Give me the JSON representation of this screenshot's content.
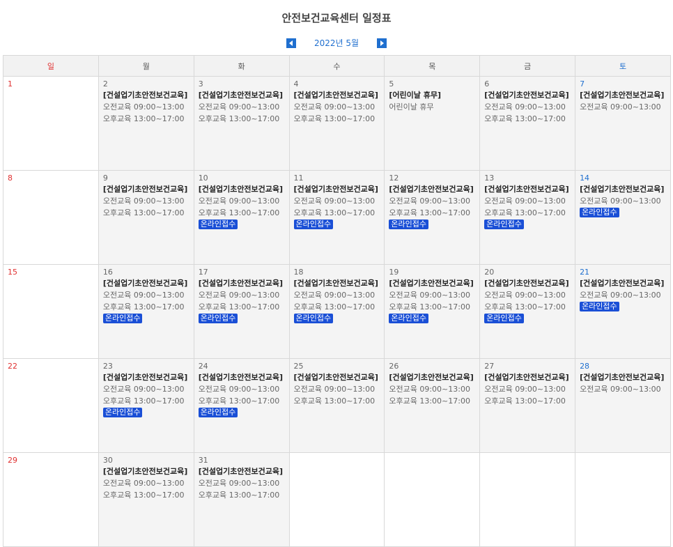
{
  "header": {
    "title": "안전보건교육센터 일정표",
    "month_label": "2022년 5월",
    "prev_icon": "triangle-left",
    "next_icon": "triangle-right"
  },
  "weekdays": [
    "일",
    "월",
    "화",
    "수",
    "목",
    "금",
    "토"
  ],
  "colors": {
    "sunday": "#e03030",
    "saturday": "#1f6fcf",
    "accent": "#1f6fcf",
    "badge": "#1a4fd6"
  },
  "weeks": [
    [
      {
        "day": "1",
        "events": []
      },
      {
        "day": "2",
        "title": "[건설업기초안전보건교육]",
        "lines": [
          "오전교육 09:00~13:00",
          "오후교육 13:00~17:00"
        ]
      },
      {
        "day": "3",
        "title": "[건설업기초안전보건교육]",
        "lines": [
          "오전교육 09:00~13:00",
          "오후교육 13:00~17:00"
        ]
      },
      {
        "day": "4",
        "title": "[건설업기초안전보건교육]",
        "lines": [
          "오전교육 09:00~13:00",
          "오후교육 13:00~17:00"
        ]
      },
      {
        "day": "5",
        "title": "[어린이날 휴무]",
        "lines": [
          "어린이날 휴무"
        ]
      },
      {
        "day": "6",
        "title": "[건설업기초안전보건교육]",
        "lines": [
          "오전교육 09:00~13:00",
          "오후교육 13:00~17:00"
        ]
      },
      {
        "day": "7",
        "title": "[건설업기초안전보건교육]",
        "lines": [
          "오전교육 09:00~13:00"
        ]
      }
    ],
    [
      {
        "day": "8"
      },
      {
        "day": "9",
        "title": "[건설업기초안전보건교육]",
        "lines": [
          "오전교육 09:00~13:00",
          "오후교육 13:00~17:00"
        ]
      },
      {
        "day": "10",
        "title": "[건설업기초안전보건교육]",
        "lines": [
          "오전교육 09:00~13:00",
          "오후교육 13:00~17:00"
        ],
        "badge": "온라인접수"
      },
      {
        "day": "11",
        "title": "[건설업기초안전보건교육]",
        "lines": [
          "오전교육 09:00~13:00",
          "오후교육 13:00~17:00"
        ],
        "badge": "온라인접수"
      },
      {
        "day": "12",
        "title": "[건설업기초안전보건교육]",
        "lines": [
          "오전교육 09:00~13:00",
          "오후교육 13:00~17:00"
        ],
        "badge": "온라인접수"
      },
      {
        "day": "13",
        "title": "[건설업기초안전보건교육]",
        "lines": [
          "오전교육 09:00~13:00",
          "오후교육 13:00~17:00"
        ],
        "badge": "온라인접수"
      },
      {
        "day": "14",
        "title": "[건설업기초안전보건교육]",
        "lines": [
          "오전교육 09:00~13:00"
        ],
        "badge": "온라인접수"
      }
    ],
    [
      {
        "day": "15"
      },
      {
        "day": "16",
        "title": "[건설업기초안전보건교육]",
        "lines": [
          "오전교육 09:00~13:00",
          "오후교육 13:00~17:00"
        ],
        "badge": "온라인접수"
      },
      {
        "day": "17",
        "title": "[건설업기초안전보건교육]",
        "lines": [
          "오전교육 09:00~13:00",
          "오후교육 13:00~17:00"
        ],
        "badge": "온라인접수"
      },
      {
        "day": "18",
        "title": "[건설업기초안전보건교육]",
        "lines": [
          "오전교육 09:00~13:00",
          "오후교육 13:00~17:00"
        ],
        "badge": "온라인접수"
      },
      {
        "day": "19",
        "title": "[건설업기초안전보건교육]",
        "lines": [
          "오전교육 09:00~13:00",
          "오후교육 13:00~17:00"
        ],
        "badge": "온라인접수"
      },
      {
        "day": "20",
        "title": "[건설업기초안전보건교육]",
        "lines": [
          "오전교육 09:00~13:00",
          "오후교육 13:00~17:00"
        ],
        "badge": "온라인접수"
      },
      {
        "day": "21",
        "title": "[건설업기초안전보건교육]",
        "lines": [
          "오전교육 09:00~13:00"
        ],
        "badge": "온라인접수"
      }
    ],
    [
      {
        "day": "22"
      },
      {
        "day": "23",
        "title": "[건설업기초안전보건교육]",
        "lines": [
          "오전교육 09:00~13:00",
          "오후교육 13:00~17:00"
        ],
        "badge": "온라인접수"
      },
      {
        "day": "24",
        "title": "[건설업기초안전보건교육]",
        "lines": [
          "오전교육 09:00~13:00",
          "오후교육 13:00~17:00"
        ],
        "badge": "온라인접수"
      },
      {
        "day": "25",
        "title": "[건설업기초안전보건교육]",
        "lines": [
          "오전교육 09:00~13:00",
          "오후교육 13:00~17:00"
        ]
      },
      {
        "day": "26",
        "title": "[건설업기초안전보건교육]",
        "lines": [
          "오전교육 09:00~13:00",
          "오후교육 13:00~17:00"
        ]
      },
      {
        "day": "27",
        "title": "[건설업기초안전보건교육]",
        "lines": [
          "오전교육 09:00~13:00",
          "오후교육 13:00~17:00"
        ]
      },
      {
        "day": "28",
        "title": "[건설업기초안전보건교육]",
        "lines": [
          "오전교육 09:00~13:00"
        ]
      }
    ],
    [
      {
        "day": "29"
      },
      {
        "day": "30",
        "title": "[건설업기초안전보건교육]",
        "lines": [
          "오전교육 09:00~13:00",
          "오후교육 13:00~17:00"
        ]
      },
      {
        "day": "31",
        "title": "[건설업기초안전보건교육]",
        "lines": [
          "오전교육 09:00~13:00",
          "오후교육 13:00~17:00"
        ]
      },
      {
        "day": ""
      },
      {
        "day": ""
      },
      {
        "day": ""
      },
      {
        "day": ""
      }
    ]
  ]
}
